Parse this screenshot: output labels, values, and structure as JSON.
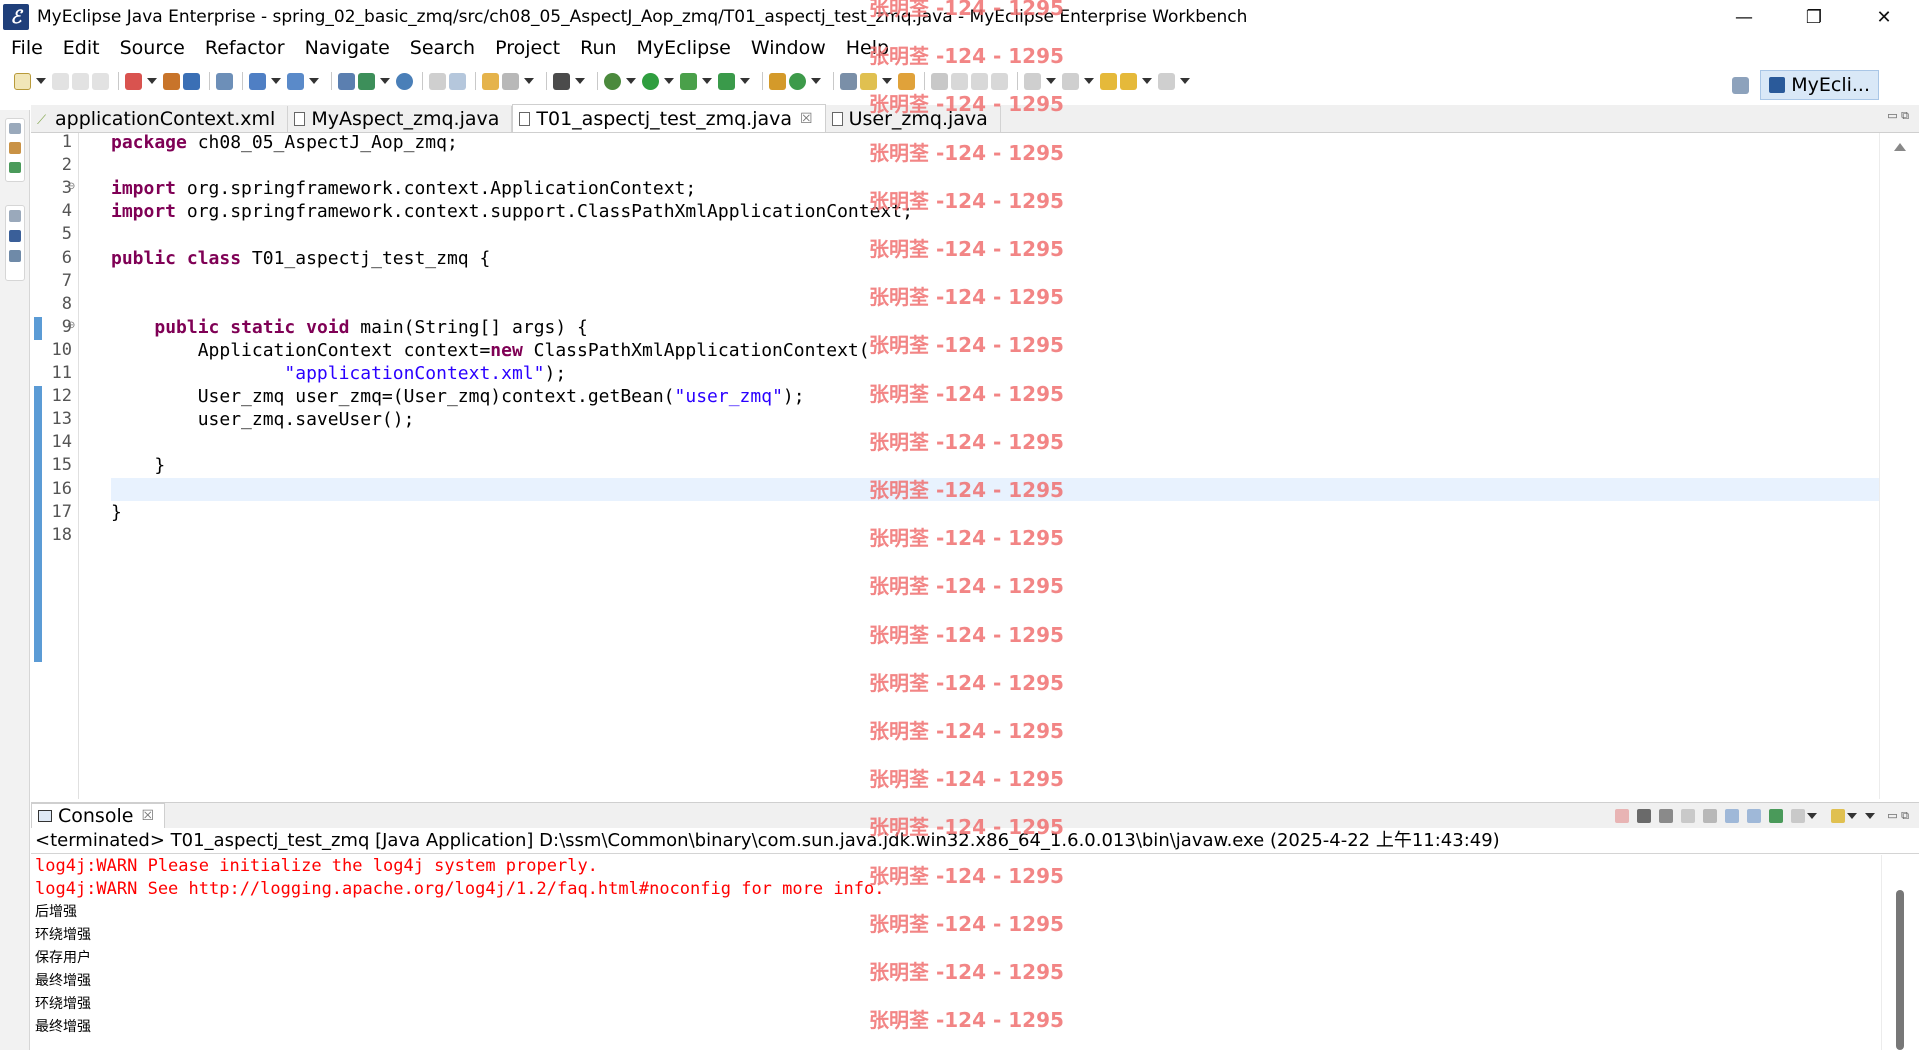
{
  "window": {
    "title": "MyEclipse Java Enterprise - spring_02_basic_zmq/src/ch08_05_AspectJ_Aop_zmq/T01_aspectj_test_zmq.java - MyEclipse Enterprise Workbench",
    "minimize": "—",
    "maximize": "❐",
    "close": "✕"
  },
  "menu": [
    "File",
    "Edit",
    "Source",
    "Refactor",
    "Navigate",
    "Search",
    "Project",
    "Run",
    "MyEclipse",
    "Window",
    "Help"
  ],
  "perspective": {
    "label": "MyEcli..."
  },
  "editor_tabs": [
    {
      "label": "applicationContext.xml",
      "active": false
    },
    {
      "label": "MyAspect_zmq.java",
      "active": false
    },
    {
      "label": "T01_aspectj_test_zmq.java",
      "active": true
    },
    {
      "label": "User_zmq.java",
      "active": false
    }
  ],
  "code_lines": [
    {
      "n": "1",
      "html": "<span class=\"kw\">package</span> ch08_05_AspectJ_Aop_zmq;"
    },
    {
      "n": "2",
      "html": ""
    },
    {
      "n": "3",
      "html": "<span class=\"kw\">import</span> org.springframework.context.ApplicationContext;",
      "fold": true
    },
    {
      "n": "4",
      "html": "<span class=\"kw\">import</span> org.springframework.context.support.ClassPathXmlApplicationContext;"
    },
    {
      "n": "5",
      "html": ""
    },
    {
      "n": "6",
      "html": "<span class=\"kw\">public</span> <span class=\"kw\">class</span> T01_aspectj_test_zmq {"
    },
    {
      "n": "7",
      "html": ""
    },
    {
      "n": "8",
      "html": ""
    },
    {
      "n": "9",
      "html": "    <span class=\"kw\">public</span> <span class=\"kw\">static</span> <span class=\"kw\">void</span> main(String[] args) {",
      "fold": true
    },
    {
      "n": "10",
      "html": "        ApplicationContext context=<span class=\"kw\">new</span> ClassPathXmlApplicationContext("
    },
    {
      "n": "11",
      "html": "                <span class=\"str\">\"applicationContext.xml\"</span>);"
    },
    {
      "n": "12",
      "html": "        User_zmq user_zmq=(User_zmq)context.getBean(<span class=\"str\">\"user_zmq\"</span>);"
    },
    {
      "n": "13",
      "html": "        user_zmq.saveUser();"
    },
    {
      "n": "14",
      "html": ""
    },
    {
      "n": "15",
      "html": "    }"
    },
    {
      "n": "16",
      "html": "",
      "current": true
    },
    {
      "n": "17",
      "html": "}"
    },
    {
      "n": "18",
      "html": ""
    }
  ],
  "console": {
    "tab_label": "Console",
    "status": "<terminated> T01_aspectj_test_zmq [Java Application] D:\\ssm\\Common\\binary\\com.sun.java.jdk.win32.x86_64_1.6.0.013\\bin\\javaw.exe (2025-4-22 上午11:43:49)",
    "lines": [
      {
        "text": "log4j:WARN Please initialize the log4j system properly.",
        "type": "err"
      },
      {
        "text": "log4j:WARN See http://logging.apache.org/log4j/1.2/faq.html#noconfig for more info.",
        "type": "err"
      },
      {
        "text": "后增强",
        "type": "out"
      },
      {
        "text": "环绕增强",
        "type": "out"
      },
      {
        "text": "保存用户",
        "type": "out"
      },
      {
        "text": "最终增强",
        "type": "out"
      },
      {
        "text": "环绕增强",
        "type": "out"
      },
      {
        "text": "最终增强",
        "type": "out"
      }
    ]
  },
  "watermark": "张明荃 -124 - 1295",
  "colors": {
    "keyword": "#7f0055",
    "string": "#2a00ff",
    "error": "#ff0000",
    "current_line": "#e8f2fe",
    "watermark": "#f07070"
  }
}
